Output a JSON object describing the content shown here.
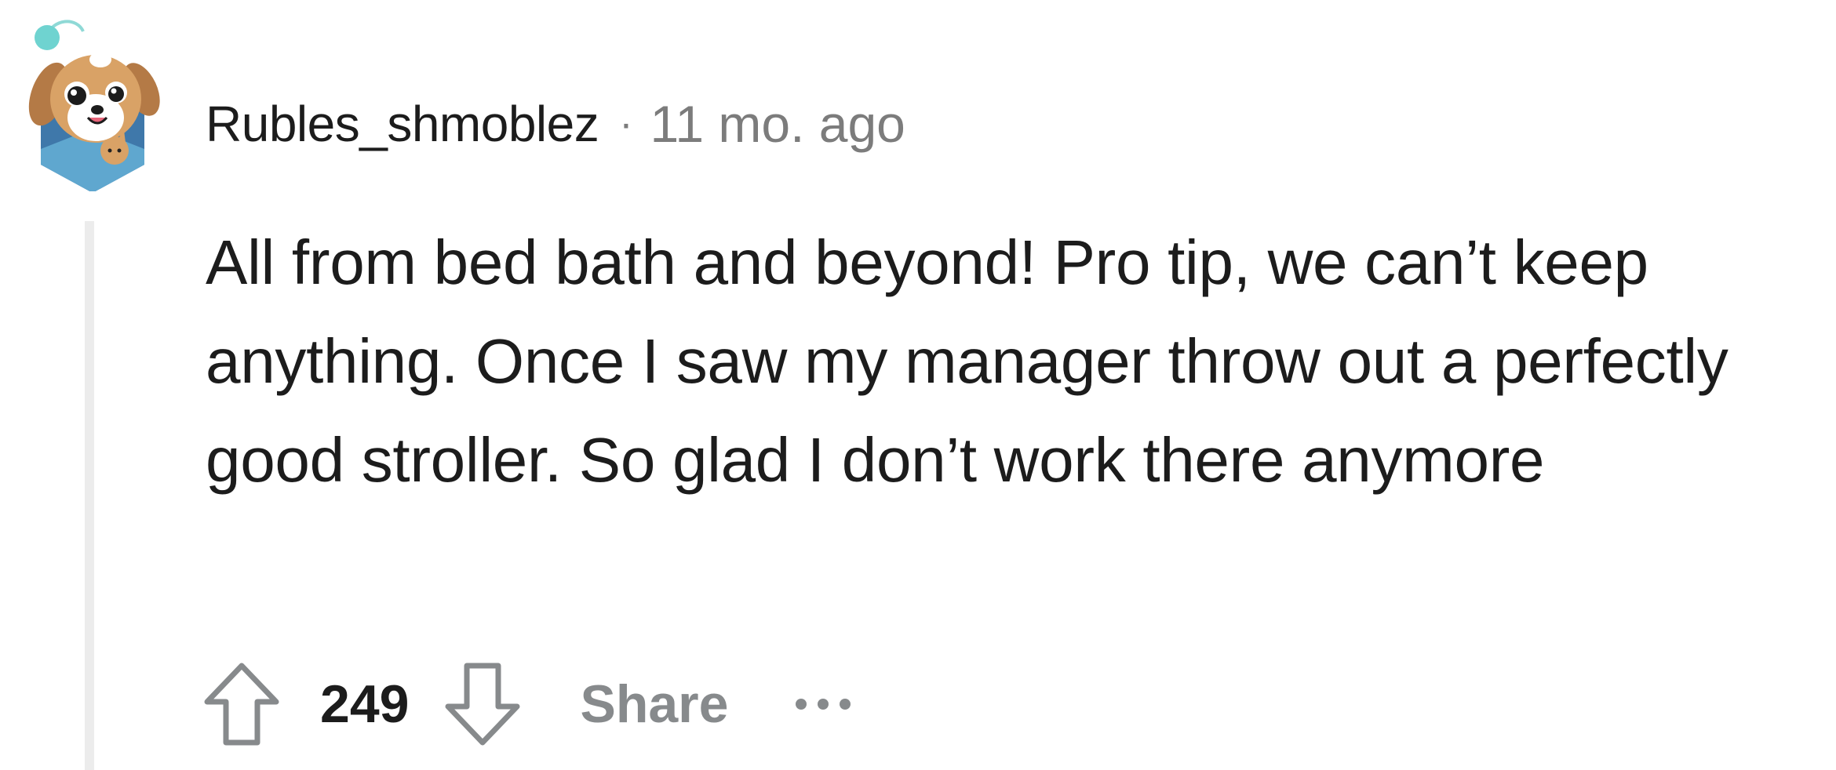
{
  "comment": {
    "username": "Rubles_shmoblez",
    "separator": "·",
    "timestamp": "11 mo. ago",
    "body": "All from bed bath and beyond! Pro tip, we can’t keep anything. Once I saw my manager throw out a perfectly good stroller. So glad I don’t work there anymore",
    "score": "249",
    "share_label": "Share",
    "icons": {
      "avatar": "dog-avatar-icon",
      "upvote": "arrow-up-icon",
      "downvote": "arrow-down-icon",
      "more": "more-options-icon"
    }
  },
  "colors": {
    "text": "#1c1c1c",
    "muted": "#7c7c7c",
    "action": "#878a8c",
    "thread_line": "#ececec",
    "avatar_bg": "#4a86b8",
    "avatar_accent": "#6fd3d0"
  }
}
